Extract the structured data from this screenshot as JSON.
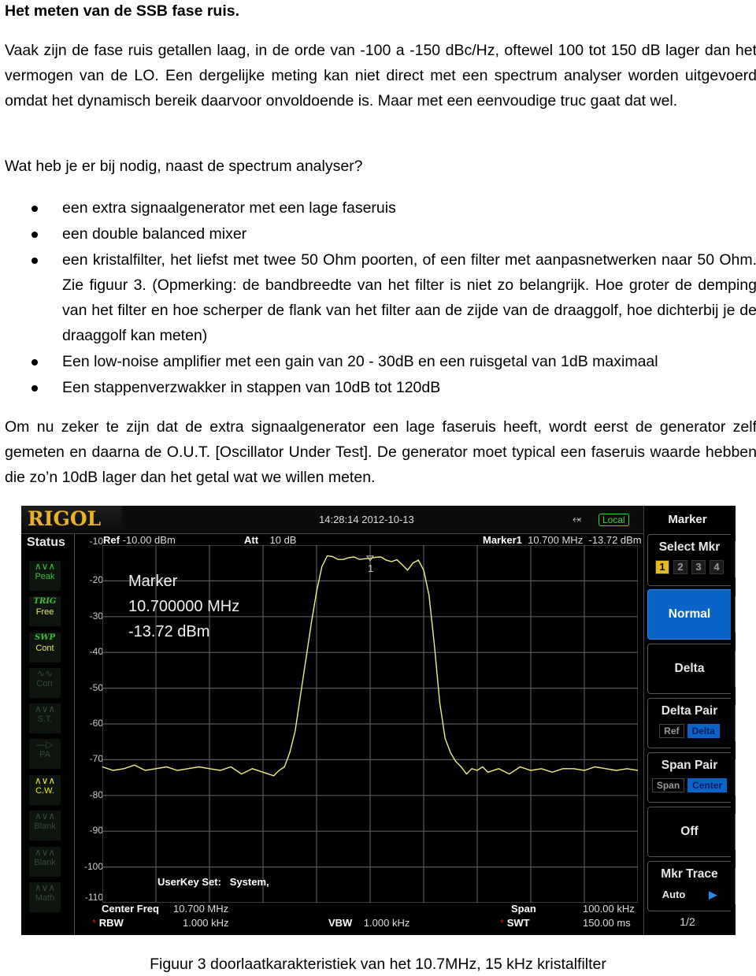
{
  "document": {
    "title": "Het meten van de SSB fase ruis.",
    "intro": "Vaak zijn de fase ruis getallen laag, in de orde van -100 a -150 dBc/Hz, oftewel 100 tot 150 dB lager dan het vermogen van de LO.  Een dergelijke meting kan niet direct met een spectrum analyser worden uitgevoerd omdat het dynamisch bereik daarvoor onvoldoende is. Maar met een eenvoudige truc gaat dat wel.",
    "question": "Wat heb je er bij nodig, naast de spectrum analyser?",
    "bullets": [
      "een extra signaalgenerator met een lage faseruis",
      "een double balanced mixer",
      "een kristalfilter, het liefst met twee 50 Ohm poorten, of een filter met aanpasnetwerken naar 50 Ohm. Zie figuur 3. (Opmerking: de bandbreedte van het filter is niet zo belangrijk. Hoe groter de demping van het filter en hoe scherper de flank van het filter aan de zijde van de draaggolf, hoe dichterbij je de draaggolf kan meten)",
      "Een low-noise amplifier met een gain van 20 - 30dB en een ruisgetal van 1dB maximaal",
      "Een stappenverzwakker in stappen van 10dB tot 120dB"
    ],
    "closing": "Om nu zeker te zijn dat de extra signaalgenerator een lage faseruis heeft, wordt eerst de generator zelf gemeten en daarna de O.U.T. [Oscillator Under Test]. De generator moet typical een faseruis waarde hebben die zo’n 10dB lager dan het getal wat we willen meten.",
    "caption": "Figuur 3 doorlaatkarakteristiek van het 10.7MHz, 15 kHz kristalfilter"
  },
  "analyzer": {
    "brand": "RIGOL",
    "datetime": "14:28:14 2012-10-13",
    "usb_icon": "usb-icon",
    "remote_status": "Local",
    "status_title": "Status",
    "status_buttons": [
      {
        "icon": "peak-icon",
        "label": "Peak",
        "state": "on"
      },
      {
        "icon": "trig-icon",
        "label": "TRIG",
        "value": "Free",
        "state": "on"
      },
      {
        "icon": "swp-icon",
        "label": "SWP",
        "value": "Cont",
        "state": "on"
      },
      {
        "icon": "corr-icon",
        "label": "Corr",
        "state": "dim"
      },
      {
        "icon": "st-icon",
        "label": "S.T.",
        "state": "dim"
      },
      {
        "icon": "pa-icon",
        "label": "PA",
        "state": "dim"
      },
      {
        "icon": "cw-icon",
        "label": "C.W.",
        "state": "active"
      },
      {
        "icon": "blank-icon",
        "label": "Blank",
        "state": "dim"
      },
      {
        "icon": "blank-icon",
        "label": "Blank",
        "state": "dim"
      },
      {
        "icon": "math-icon",
        "label": "Math",
        "state": "dim"
      }
    ],
    "header": {
      "ref_label": "Ref",
      "ref_value": "-10.00 dBm",
      "att_label": "Att",
      "att_value": "10 dB",
      "marker_label": "Marker1",
      "marker_freq": "10.700 MHz",
      "marker_level": "-13.72 dBm"
    },
    "marker_readout": {
      "title": "Marker",
      "freq": "10.700000 MHz",
      "level": "-13.72 dBm"
    },
    "userkey": {
      "label": "UserKey Set:",
      "value": "System,"
    },
    "footer": {
      "center_label": "Center Freq",
      "center_value": "10.700 MHz",
      "rbw_label": "RBW",
      "rbw_value": "1.000 kHz",
      "vbw_label": "VBW",
      "vbw_value": "1.000 kHz",
      "span_label": "Span",
      "span_value": "100.00 kHz",
      "swt_label": "SWT",
      "swt_value": "150.00 ms",
      "star": "*"
    },
    "softkeys": {
      "title": "Marker",
      "select_mkr": {
        "label": "Select Mkr",
        "numbers": [
          "1",
          "2",
          "3",
          "4"
        ],
        "active": "1"
      },
      "normal": "Normal",
      "delta": "Delta",
      "delta_pair": {
        "label": "Delta Pair",
        "options": [
          "Ref",
          "Delta"
        ],
        "active": "Delta"
      },
      "span_pair": {
        "label": "Span Pair",
        "options": [
          "Span",
          "Center"
        ],
        "active": "Center"
      },
      "off": "Off",
      "mkr_trace": {
        "label": "Mkr Trace",
        "value": "Auto"
      },
      "page": "1/2"
    },
    "colors": {
      "trace": "#f0f080",
      "grid": "#5a5a5a",
      "brand": "#e7b322",
      "selected": "#0a64c8"
    }
  },
  "chart_data": {
    "type": "line",
    "title": "",
    "xlabel": "Frequency (Center 10.700 MHz, Span 100.00 kHz)",
    "ylabel": "dBm",
    "x_range_khz": [
      -50,
      50
    ],
    "ylim": [
      -110,
      -10
    ],
    "y_ticks": [
      "-10",
      "-20",
      "-30",
      "-40",
      "-50",
      "-60",
      "-70",
      "-80",
      "-90",
      "-100",
      "-110"
    ],
    "grid": true,
    "marker": {
      "label": "1",
      "x_khz": 0,
      "y": -13.72
    },
    "series": [
      {
        "name": "Trace 1",
        "x_khz": [
          -50,
          -48,
          -46,
          -44,
          -42,
          -40,
          -38,
          -36,
          -34,
          -32,
          -30,
          -28,
          -26,
          -24,
          -22,
          -20,
          -19,
          -18,
          -17,
          -16,
          -15,
          -14,
          -13,
          -12,
          -11,
          -10,
          -9,
          -8,
          -7,
          -6,
          -5,
          -4,
          -3,
          -2,
          -1,
          0,
          1,
          2,
          3,
          4,
          5,
          6,
          7,
          8,
          9,
          10,
          11,
          12,
          13,
          14,
          15,
          16,
          17,
          18,
          19,
          20,
          21,
          22,
          24,
          26,
          28,
          30,
          32,
          34,
          36,
          38,
          40,
          42,
          44,
          46,
          48,
          50
        ],
        "values": [
          -72,
          -73,
          -72.5,
          -71.5,
          -73,
          -72.5,
          -72,
          -73,
          -72.5,
          -72,
          -72.5,
          -73,
          -72,
          -74,
          -72.5,
          -73.5,
          -74,
          -74.5,
          -73,
          -72,
          -68,
          -62,
          -52,
          -42,
          -32,
          -23,
          -16,
          -13,
          -13.2,
          -14,
          -14,
          -13.5,
          -13.3,
          -14,
          -13.8,
          -13.7,
          -13.4,
          -13.3,
          -14.2,
          -14.6,
          -14.1,
          -15.5,
          -17,
          -15,
          -14.2,
          -17,
          -24,
          -38,
          -54,
          -64,
          -68,
          -70.5,
          -72,
          -74,
          -72.5,
          -73,
          -72,
          -73.5,
          -72.5,
          -74,
          -72,
          -73,
          -72.5,
          -73.5,
          -72.5,
          -72.5,
          -73,
          -72,
          -72.5,
          -73,
          -72.5,
          -73
        ]
      }
    ]
  }
}
